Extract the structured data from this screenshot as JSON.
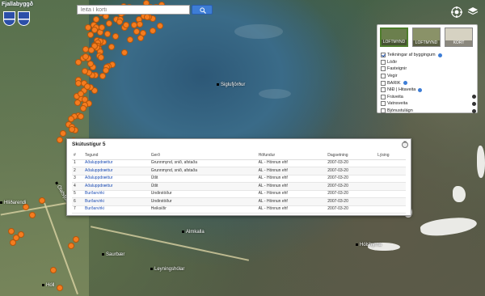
{
  "logo": {
    "text": "Fjallabyggð"
  },
  "search": {
    "placeholder": "leita í korti",
    "value": ""
  },
  "panel": {
    "basemaps": [
      {
        "label": "LOFTMYND",
        "active": true,
        "color": "#6b7f4d"
      },
      {
        "label": "LOFTMYND",
        "active": false,
        "color": "#8a9268"
      },
      {
        "label": "KORT",
        "active": false,
        "color": "#d6d2c2"
      }
    ],
    "layers": [
      {
        "label": "Teikningar af byggingum",
        "checked": true,
        "info": "blue"
      },
      {
        "label": "Lóðir",
        "checked": false,
        "info": ""
      },
      {
        "label": "Fasteignir",
        "checked": false,
        "info": ""
      },
      {
        "label": "Vegir",
        "checked": false,
        "info": ""
      },
      {
        "label": "BARIK",
        "checked": false,
        "info": "blue"
      },
      {
        "label": "NIÐ | Hitaveita",
        "checked": false,
        "info": "blue"
      },
      {
        "label": "Fráveita",
        "checked": false,
        "info": "dark"
      },
      {
        "label": "Vatnsveita",
        "checked": false,
        "info": "dark"
      },
      {
        "label": "Bjónustulágn",
        "checked": false,
        "info": "dark"
      }
    ]
  },
  "popup": {
    "title": "Skútustígur 5",
    "columns": [
      "#",
      "Tegund",
      "Gerð",
      "Höfundur",
      "Dagsetning",
      "Lýsing"
    ],
    "rows": [
      [
        "1",
        "Aðaluppdrættur",
        "Grunnmynd, snið, afstaða",
        "AL - Hönnun ehf",
        "2007-03-20",
        ""
      ],
      [
        "2",
        "Aðaluppdrættur",
        "Grunnmynd, snið, afstaða",
        "AL - Hönnun ehf",
        "2007-03-20",
        ""
      ],
      [
        "3",
        "Aðaluppdrættur",
        "Útlit",
        "AL - Hönnun ehf",
        "2007-03-20",
        ""
      ],
      [
        "4",
        "Aðaluppdrættur",
        "Útlit",
        "AL - Hönnun ehf",
        "2007-03-20",
        ""
      ],
      [
        "5",
        "Burðarvirki",
        "Undirstöður",
        "AL - Hönnun ehf",
        "2007-03-20",
        ""
      ],
      [
        "6",
        "Burðarvirki",
        "Undirstöður",
        "AL - Hönnun ehf",
        "2007-03-20",
        ""
      ],
      [
        "7",
        "Burðarvirki",
        "Heiksiðir",
        "AL - Hönnun ehf",
        "2007-03-20",
        ""
      ]
    ]
  },
  "places": [
    {
      "label": "Siglufjörður"
    },
    {
      "label": "Hólshyrna"
    },
    {
      "label": "Ólafsfjörður"
    },
    {
      "label": "Hóll"
    },
    {
      "label": "Saurbær"
    },
    {
      "label": "Leyningshólar"
    },
    {
      "label": "Almkalla"
    },
    {
      "label": "Hlíðarendi"
    }
  ],
  "colors": {
    "marker": "#f57c1f",
    "accent": "#3d7dd6"
  }
}
